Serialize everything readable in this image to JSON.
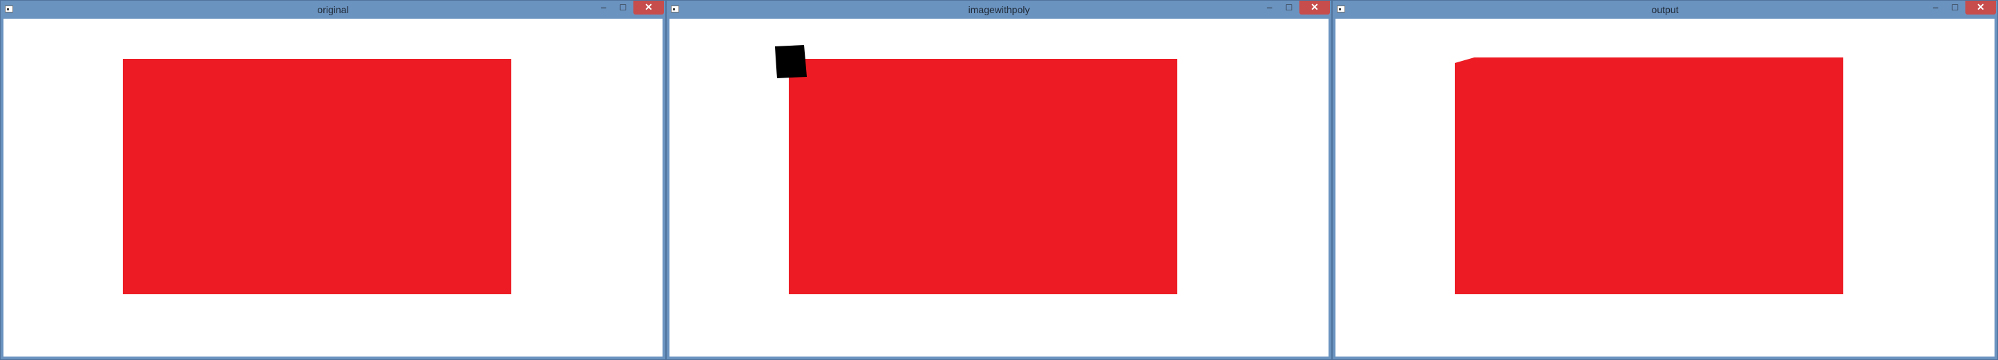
{
  "windows": [
    {
      "id": "original",
      "title": "original",
      "buttons": {
        "minimize": "–",
        "maximize": "□",
        "close": "✕"
      }
    },
    {
      "id": "imagewithpoly",
      "title": "imagewithpoly",
      "buttons": {
        "minimize": "–",
        "maximize": "□",
        "close": "✕"
      }
    },
    {
      "id": "output",
      "title": "output",
      "buttons": {
        "minimize": "–",
        "maximize": "□",
        "close": "✕"
      }
    }
  ],
  "colors": {
    "window_frame": "#6b93c0",
    "close_button": "#c74c4c",
    "rectangle_fill": "#ed1c24",
    "polygon_fill": "#000000",
    "canvas_background": "#ffffff"
  },
  "icons": {
    "app": "app-window-icon",
    "minimize": "minimize-icon",
    "maximize": "maximize-icon",
    "close": "close-icon"
  }
}
